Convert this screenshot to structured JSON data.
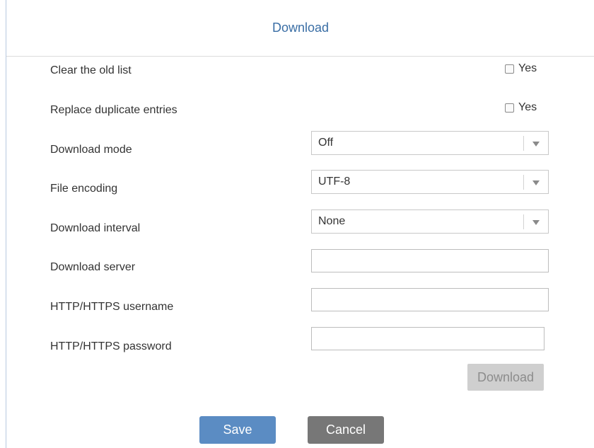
{
  "dialog": {
    "title": "Download"
  },
  "form": {
    "clear_old_list": {
      "label": "Clear the old list",
      "checkbox_label": "Yes",
      "checked": false
    },
    "replace_duplicates": {
      "label": "Replace duplicate entries",
      "checkbox_label": "Yes",
      "checked": false
    },
    "download_mode": {
      "label": "Download mode",
      "value": "Off"
    },
    "file_encoding": {
      "label": "File encoding",
      "value": "UTF-8"
    },
    "download_interval": {
      "label": "Download interval",
      "value": "None"
    },
    "download_server": {
      "label": "Download server",
      "value": "",
      "placeholder": ""
    },
    "http_username": {
      "label": "HTTP/HTTPS username",
      "value": "",
      "placeholder": ""
    },
    "http_password": {
      "label": "HTTP/HTTPS password",
      "value": "",
      "placeholder": ""
    }
  },
  "buttons": {
    "download": "Download",
    "save": "Save",
    "cancel": "Cancel"
  },
  "colors": {
    "title": "#3a6ea5",
    "save_button": "#5b8cc3",
    "cancel_button": "#777777",
    "download_button_disabled": "#cfcfcf"
  },
  "icons": {
    "select_arrow": "chevron-down-icon"
  }
}
